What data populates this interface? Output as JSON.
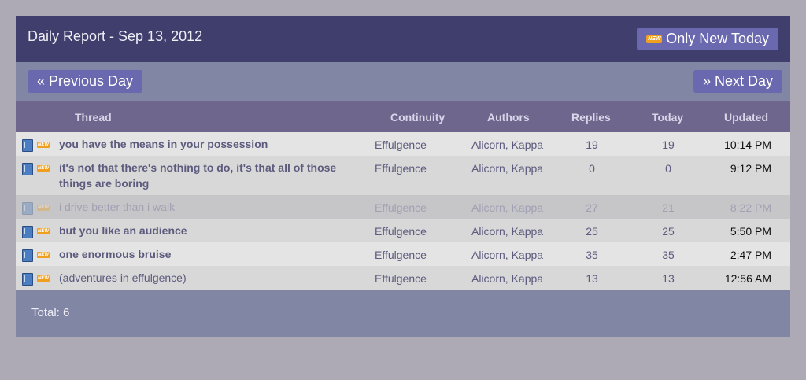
{
  "header": {
    "title": "Daily Report - Sep 13, 2012",
    "only_new_label": "Only New Today",
    "new_badge": "NEW"
  },
  "nav": {
    "prev_label": "« Previous Day",
    "next_label": "» Next Day"
  },
  "table": {
    "columns": [
      "Thread",
      "Continuity",
      "Authors",
      "Replies",
      "Today",
      "Updated"
    ],
    "rows": [
      {
        "thread": "you have the means in your possession",
        "continuity": "Effulgence",
        "author1": "Alicorn",
        "author2": "Kappa",
        "replies": "19",
        "today": "19",
        "updated": "10:14 PM",
        "badge": "NEW"
      },
      {
        "thread": "it's not that there's nothing to do, it's that all of those things are boring",
        "continuity": "Effulgence",
        "author1": "Alicorn",
        "author2": "Kappa",
        "replies": "0",
        "today": "0",
        "updated": "9:12 PM",
        "badge": "NEW"
      },
      {
        "thread": "i drive better than i walk",
        "continuity": "Effulgence",
        "author1": "Alicorn",
        "author2": "Kappa",
        "replies": "27",
        "today": "21",
        "updated": "8:22 PM",
        "badge": "NEW"
      },
      {
        "thread": "but you like an audience",
        "continuity": "Effulgence",
        "author1": "Alicorn",
        "author2": "Kappa",
        "replies": "25",
        "today": "25",
        "updated": "5:50 PM",
        "badge": "NEW"
      },
      {
        "thread": "one enormous bruise",
        "continuity": "Effulgence",
        "author1": "Alicorn",
        "author2": "Kappa",
        "replies": "35",
        "today": "35",
        "updated": "2:47 PM",
        "badge": "NEW"
      },
      {
        "thread": "(adventures in effulgence)",
        "continuity": "Effulgence",
        "author1": "Alicorn",
        "author2": "Kappa",
        "replies": "13",
        "today": "13",
        "updated": "12:56 AM",
        "badge": "NEW"
      }
    ]
  },
  "footer": {
    "total": "Total: 6"
  }
}
